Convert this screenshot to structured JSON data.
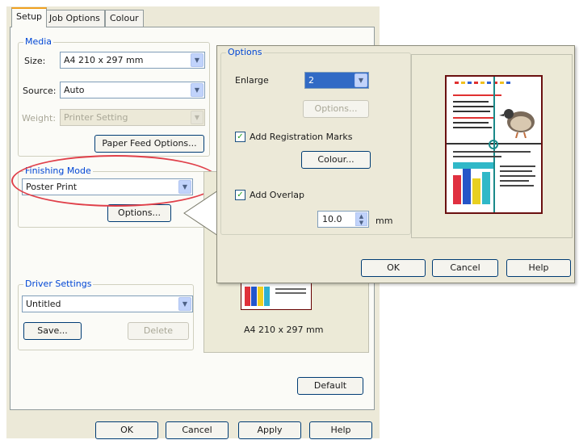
{
  "tabs": [
    {
      "label": "Setup",
      "active": true
    },
    {
      "label": "Job Options",
      "active": false
    },
    {
      "label": "Colour",
      "active": false
    }
  ],
  "media": {
    "group_label": "Media",
    "size_label": "Size:",
    "size_value": "A4 210 x 297 mm",
    "source_label": "Source:",
    "source_value": "Auto",
    "weight_label": "Weight:",
    "weight_value": "Printer Setting",
    "paper_feed_button": "Paper Feed Options..."
  },
  "finishing": {
    "group_label": "Finishing Mode",
    "mode_value": "Poster Print",
    "options_button": "Options..."
  },
  "driver": {
    "group_label": "Driver Settings",
    "value": "Untitled",
    "save_button": "Save...",
    "delete_button": "Delete"
  },
  "preview_caption": "A4 210 x 297 mm",
  "default_button": "Default",
  "bottom_buttons": {
    "ok": "OK",
    "cancel": "Cancel",
    "apply": "Apply",
    "help": "Help"
  },
  "options_dialog": {
    "group_label": "Options",
    "enlarge_label": "Enlarge",
    "enlarge_value": "2",
    "options_button": "Options...",
    "add_registration_marks": {
      "label": "Add Registration Marks",
      "checked": true
    },
    "colour_button": "Colour...",
    "add_overlap": {
      "label": "Add Overlap",
      "checked": true
    },
    "overlap_value": "10.0",
    "overlap_unit": "mm",
    "ok": "OK",
    "cancel": "Cancel",
    "help": "Help"
  },
  "colors": {
    "highlight_ellipse": "#e0404a",
    "accent_blue": "#0046d5",
    "enlarge_select": "#316ac5"
  }
}
